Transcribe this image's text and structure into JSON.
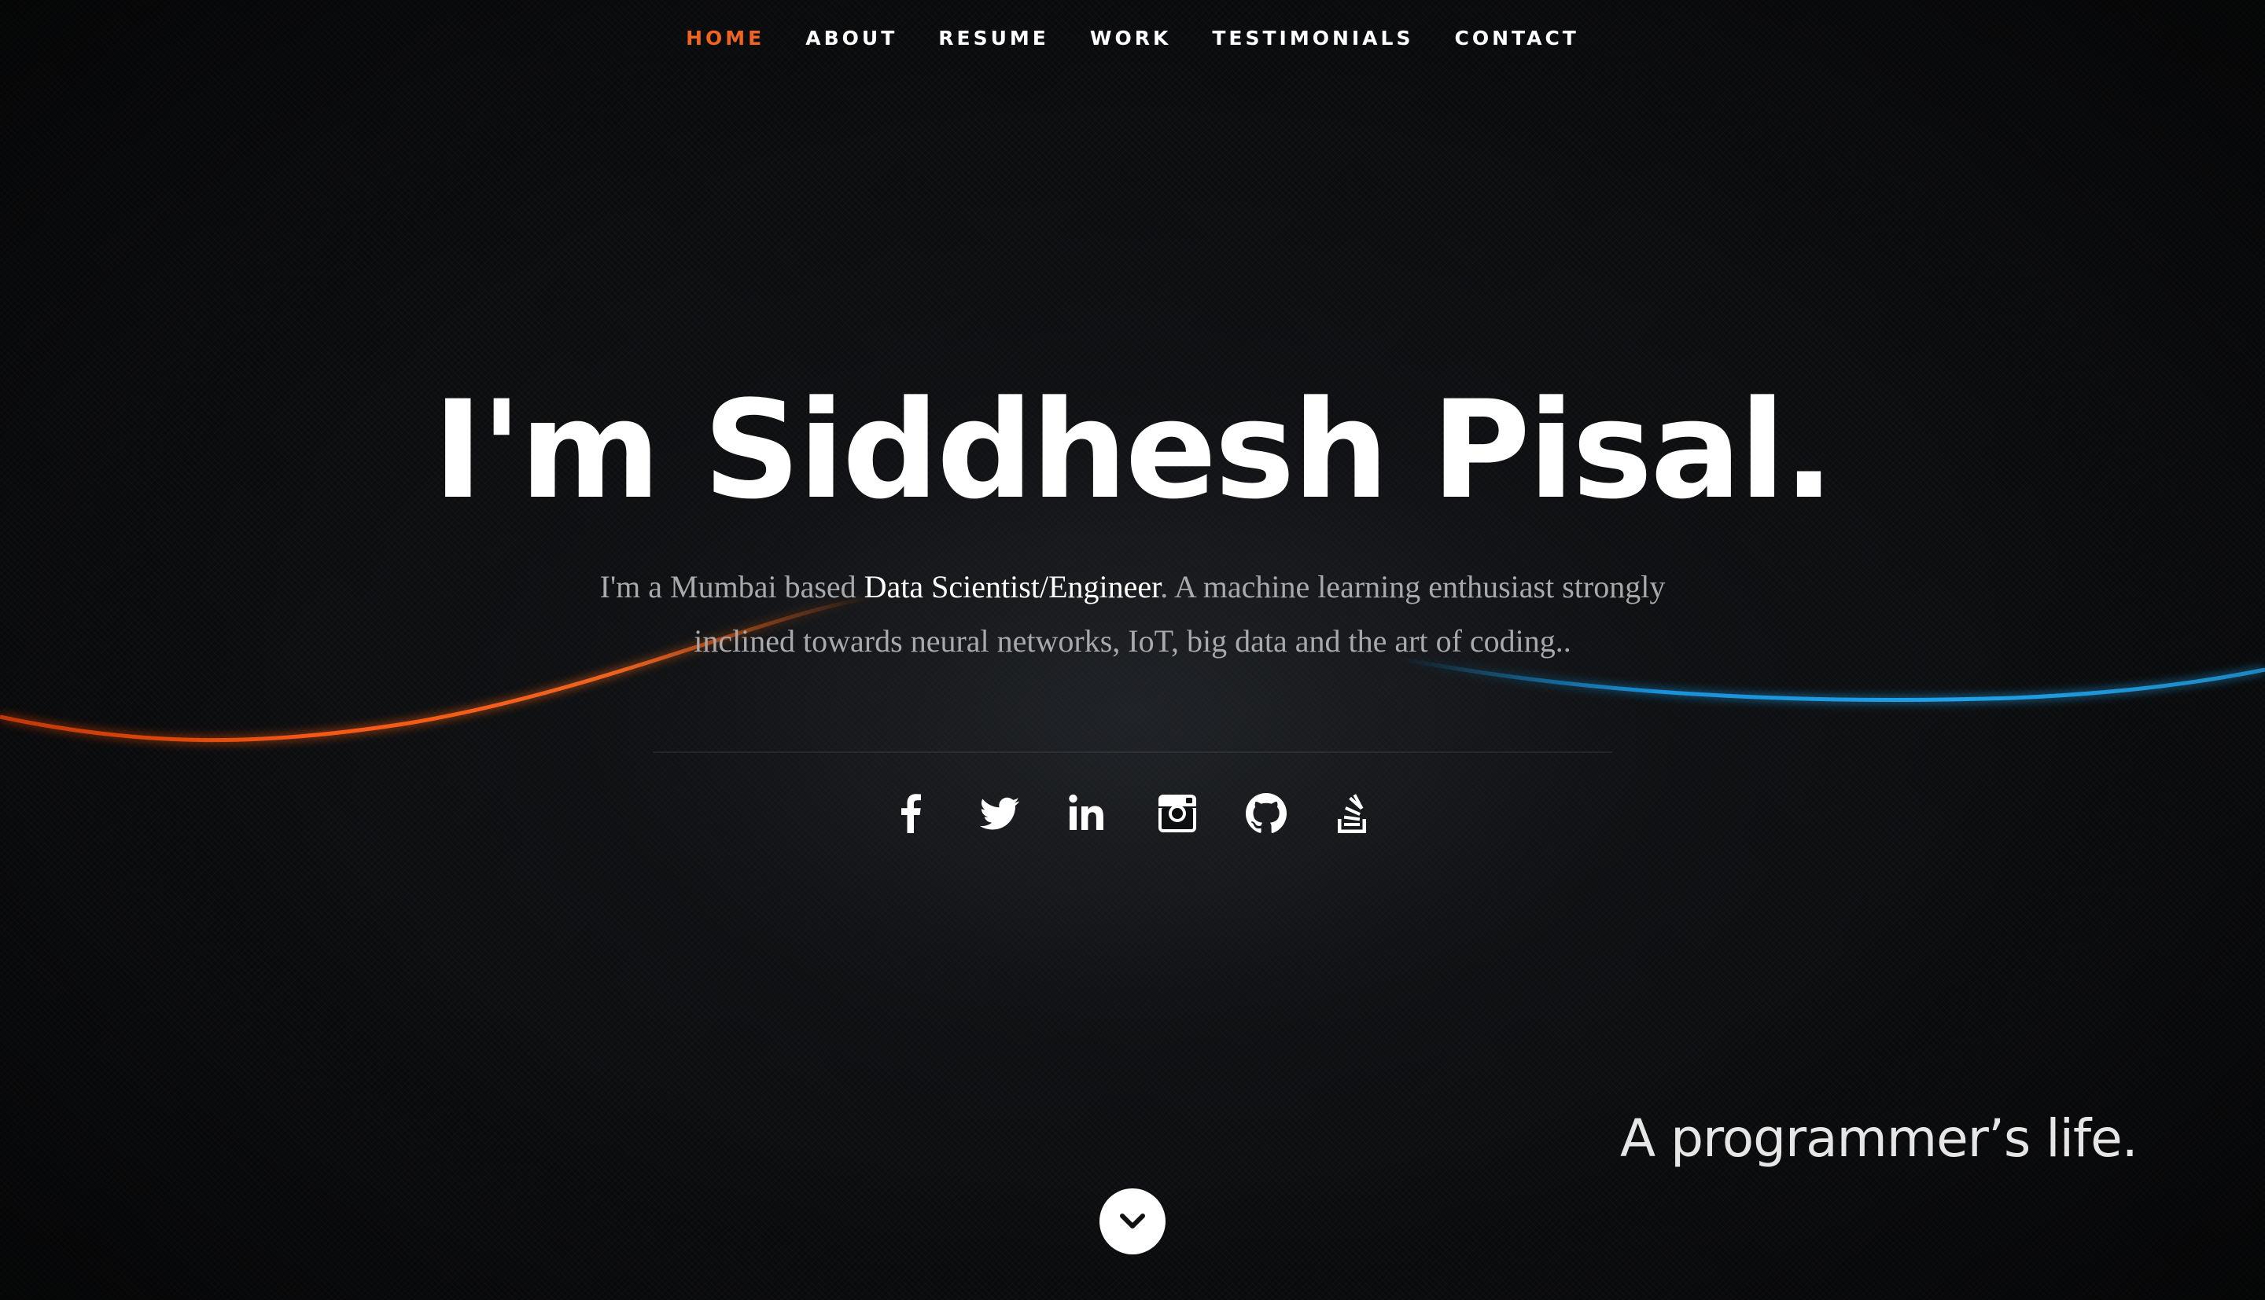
{
  "nav": {
    "items": [
      {
        "label": "HOME",
        "active": true
      },
      {
        "label": "ABOUT",
        "active": false
      },
      {
        "label": "RESUME",
        "active": false
      },
      {
        "label": "WORK",
        "active": false
      },
      {
        "label": "TESTIMONIALS",
        "active": false
      },
      {
        "label": "CONTACT",
        "active": false
      }
    ]
  },
  "hero": {
    "headline": "I'm Siddhesh Pisal.",
    "intro_before": "I'm a Mumbai based ",
    "intro_highlight": "Data Scientist/Engineer",
    "intro_after": ". A machine learning enthusiast strongly inclined towards neural networks, IoT, big data and the art of coding..",
    "tagline": "A programmer’s life."
  },
  "social": [
    {
      "icon": "facebook-icon"
    },
    {
      "icon": "twitter-icon"
    },
    {
      "icon": "linkedin-icon"
    },
    {
      "icon": "instagram-icon"
    },
    {
      "icon": "github-icon"
    },
    {
      "icon": "stackoverflow-icon"
    }
  ],
  "scroll_down": {
    "icon": "chevron-down-icon"
  },
  "colors": {
    "accent": "#f0641e",
    "wave_orange": "#ff5a14",
    "wave_blue": "#1aa0f0",
    "background": "#0b0c0e",
    "text": "#ffffff",
    "muted_text": "#a9a9ab"
  }
}
